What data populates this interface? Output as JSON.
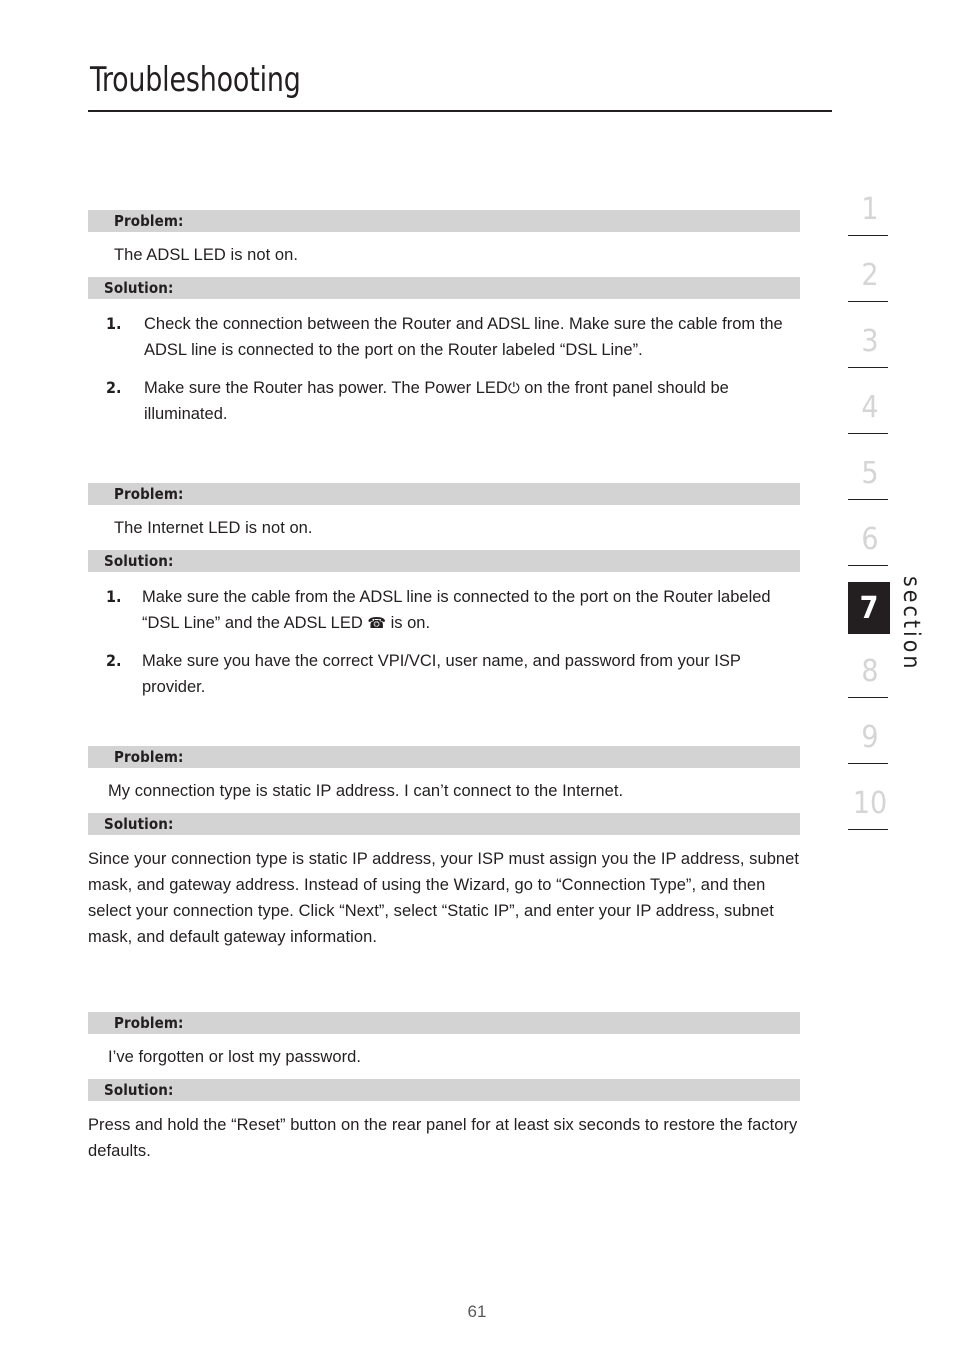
{
  "page": {
    "title": "Troubleshooting",
    "number": "61"
  },
  "labels": {
    "problem": "Problem:",
    "solution": "Solution:"
  },
  "icons": {
    "power": "⏻",
    "telephone": "☎"
  },
  "entries": [
    {
      "problem": "The ADSL LED is not on.",
      "steps": [
        {
          "num": "1.",
          "text": "Check the connection between the Router and ADSL line. Make sure the cable from the ADSL line is connected to the port on the Router labeled “DSL Line”."
        },
        {
          "num": "2.",
          "text_before": "Make sure the Router has power. The Power LED",
          "icon": "power",
          "text_after": "on the front panel should be illuminated."
        }
      ]
    },
    {
      "problem": "The Internet LED is not on.",
      "steps": [
        {
          "num": "1.",
          "text_before": "Make sure the cable from the ADSL line is connected to the port on the Router labeled “DSL Line” and the ADSL LED",
          "icon": "telephone",
          "text_after": "is on."
        },
        {
          "num": "2.",
          "text": "Make sure you have the correct VPI/VCI, user name, and password from your ISP provider."
        }
      ]
    },
    {
      "problem": "My connection type is static IP address. I can’t connect to the Internet.",
      "paragraph": "Since your connection type is static IP address, your ISP must assign you the IP address, subnet mask, and gateway address. Instead of using the Wizard, go to “Connection Type”, and then select your connection type. Click “Next”, select “Static IP”, and enter your IP address, subnet mask, and default gateway information."
    },
    {
      "problem": "I’ve forgotten or lost my password.",
      "paragraph": "Press and hold the “Reset” button on the rear panel for at least six seconds to restore the factory defaults."
    }
  ],
  "sidebar": {
    "label": "section",
    "tabs": [
      {
        "number": "1",
        "active": false
      },
      {
        "number": "2",
        "active": false
      },
      {
        "number": "3",
        "active": false
      },
      {
        "number": "4",
        "active": false
      },
      {
        "number": "5",
        "active": false
      },
      {
        "number": "6",
        "active": false
      },
      {
        "number": "7",
        "active": true
      },
      {
        "number": "8",
        "active": false
      },
      {
        "number": "9",
        "active": false
      },
      {
        "number": "10",
        "active": false
      }
    ]
  },
  "colors": {
    "band_gray": "#d3d3d3",
    "ink": "#231f20",
    "tab_inactive": "#d5d5d5",
    "page_number": "#58595b"
  }
}
